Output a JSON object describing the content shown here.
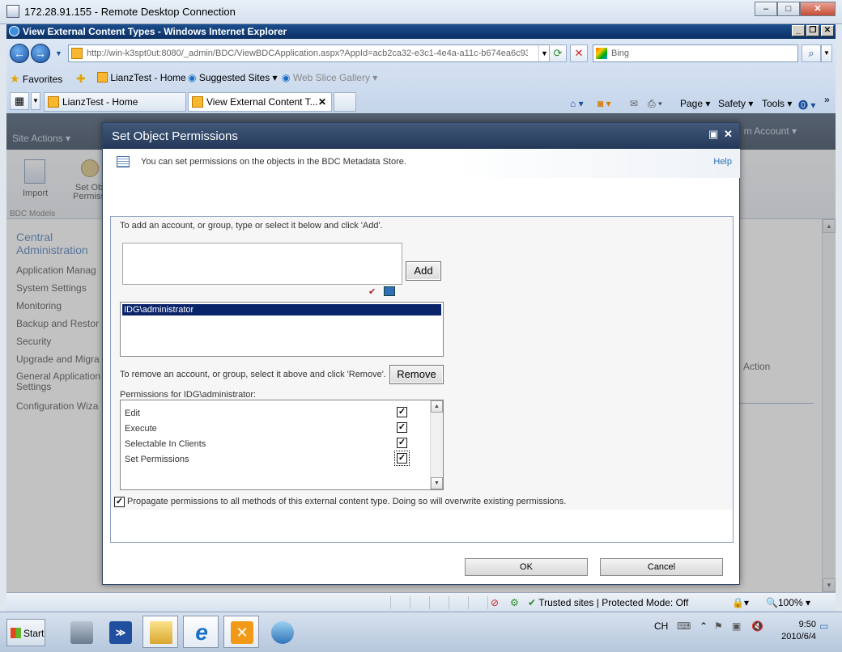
{
  "rdp": {
    "title": "172.28.91.155 - Remote Desktop Connection",
    "min": "–",
    "max": "□",
    "close": "✕"
  },
  "ie": {
    "title": "View External Content Types - Windows Internet Explorer",
    "address": "http://win-k3spt0ut:8080/_admin/BDC/ViewBDCApplication.aspx?AppId=acb2ca32-e3c1-4e4a-a11c-b674ea6c93b",
    "search_placeholder": "Bing",
    "favorites_label": "Favorites",
    "fav_links": [
      "LianzTest - Home",
      "Suggested Sites ▾",
      "Web Slice Gallery ▾"
    ],
    "tabs": [
      "LianzTest - Home",
      "View External Content T..."
    ],
    "commands": [
      "Page ▾",
      "Safety ▾",
      "Tools ▾"
    ],
    "status": {
      "zone": "Trusted sites | Protected Mode: Off",
      "zoom": "100%"
    }
  },
  "sharepoint": {
    "site_actions": "Site Actions ▾",
    "account": "m Account ▾",
    "tool_import": "Import",
    "tool_setobj": "Set Ob\nPermiss",
    "group_label": "BDC Models",
    "nav_head": "Central Administration",
    "nav_links": [
      "Application Manag",
      "System Settings",
      "Monitoring",
      "Backup and Restor",
      "Security",
      "Upgrade and Migra",
      "General Application Settings",
      "Configuration Wiza"
    ],
    "action_label": "Action"
  },
  "dialog": {
    "title": "Set Object Permissions",
    "info": "You can set permissions on the objects in the BDC Metadata Store.",
    "help": "Help",
    "add_instruction": "To add an account, or group, type or select it below and click 'Add'.",
    "add_button": "Add",
    "accounts": [
      "IDG\\administrator"
    ],
    "remove_instruction": "To remove an account, or group, select it above and click 'Remove'.",
    "remove_button": "Remove",
    "permissions_for": "Permissions for IDG\\administrator:",
    "permissions": [
      {
        "label": "Edit",
        "checked": true
      },
      {
        "label": "Execute",
        "checked": true
      },
      {
        "label": "Selectable In Clients",
        "checked": true
      },
      {
        "label": "Set Permissions",
        "checked": true
      }
    ],
    "propagate": "Propagate permissions to all methods of this external content type. Doing so will overwrite existing permissions.",
    "ok": "OK",
    "cancel": "Cancel"
  },
  "taskbar": {
    "start": "Start",
    "lang": "CH",
    "time": "9:50",
    "date": "2010/6/4"
  }
}
